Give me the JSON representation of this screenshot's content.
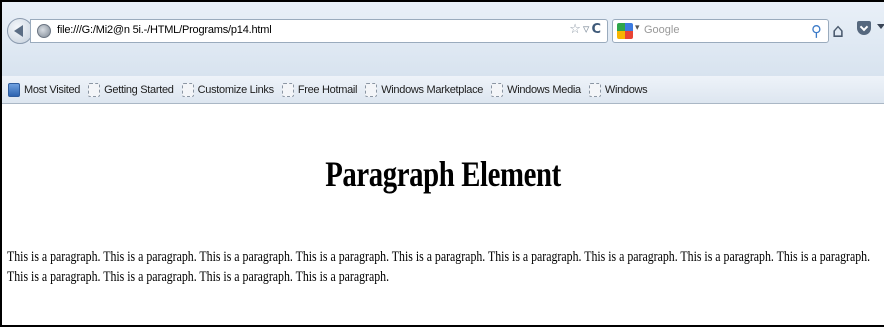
{
  "browser": {
    "url": "file:///G:/Mi2@n 5i.-/HTML/Programs/p14.html",
    "search_placeholder": "Google"
  },
  "bookmarks": [
    {
      "label": "Most Visited",
      "icon": "most-visited-icon"
    },
    {
      "label": "Getting Started",
      "icon": "page-icon"
    },
    {
      "label": "Customize Links",
      "icon": "page-icon"
    },
    {
      "label": "Free Hotmail",
      "icon": "page-icon"
    },
    {
      "label": "Windows Marketplace",
      "icon": "page-icon"
    },
    {
      "label": "Windows Media",
      "icon": "page-icon"
    },
    {
      "label": "Windows",
      "icon": "page-icon"
    }
  ],
  "page": {
    "heading": "Paragraph Element",
    "paragraph": "This is a paragraph. This is a paragraph. This is a paragraph. This is a paragraph. This is a paragraph. This is a paragraph. This is a paragraph. This is a paragraph. This is a paragraph. This is a paragraph. This is a paragraph. This is a paragraph. This is a paragraph."
  },
  "colors": {
    "toolbar": "#dde6f0",
    "accent": "#3d7bc8"
  }
}
